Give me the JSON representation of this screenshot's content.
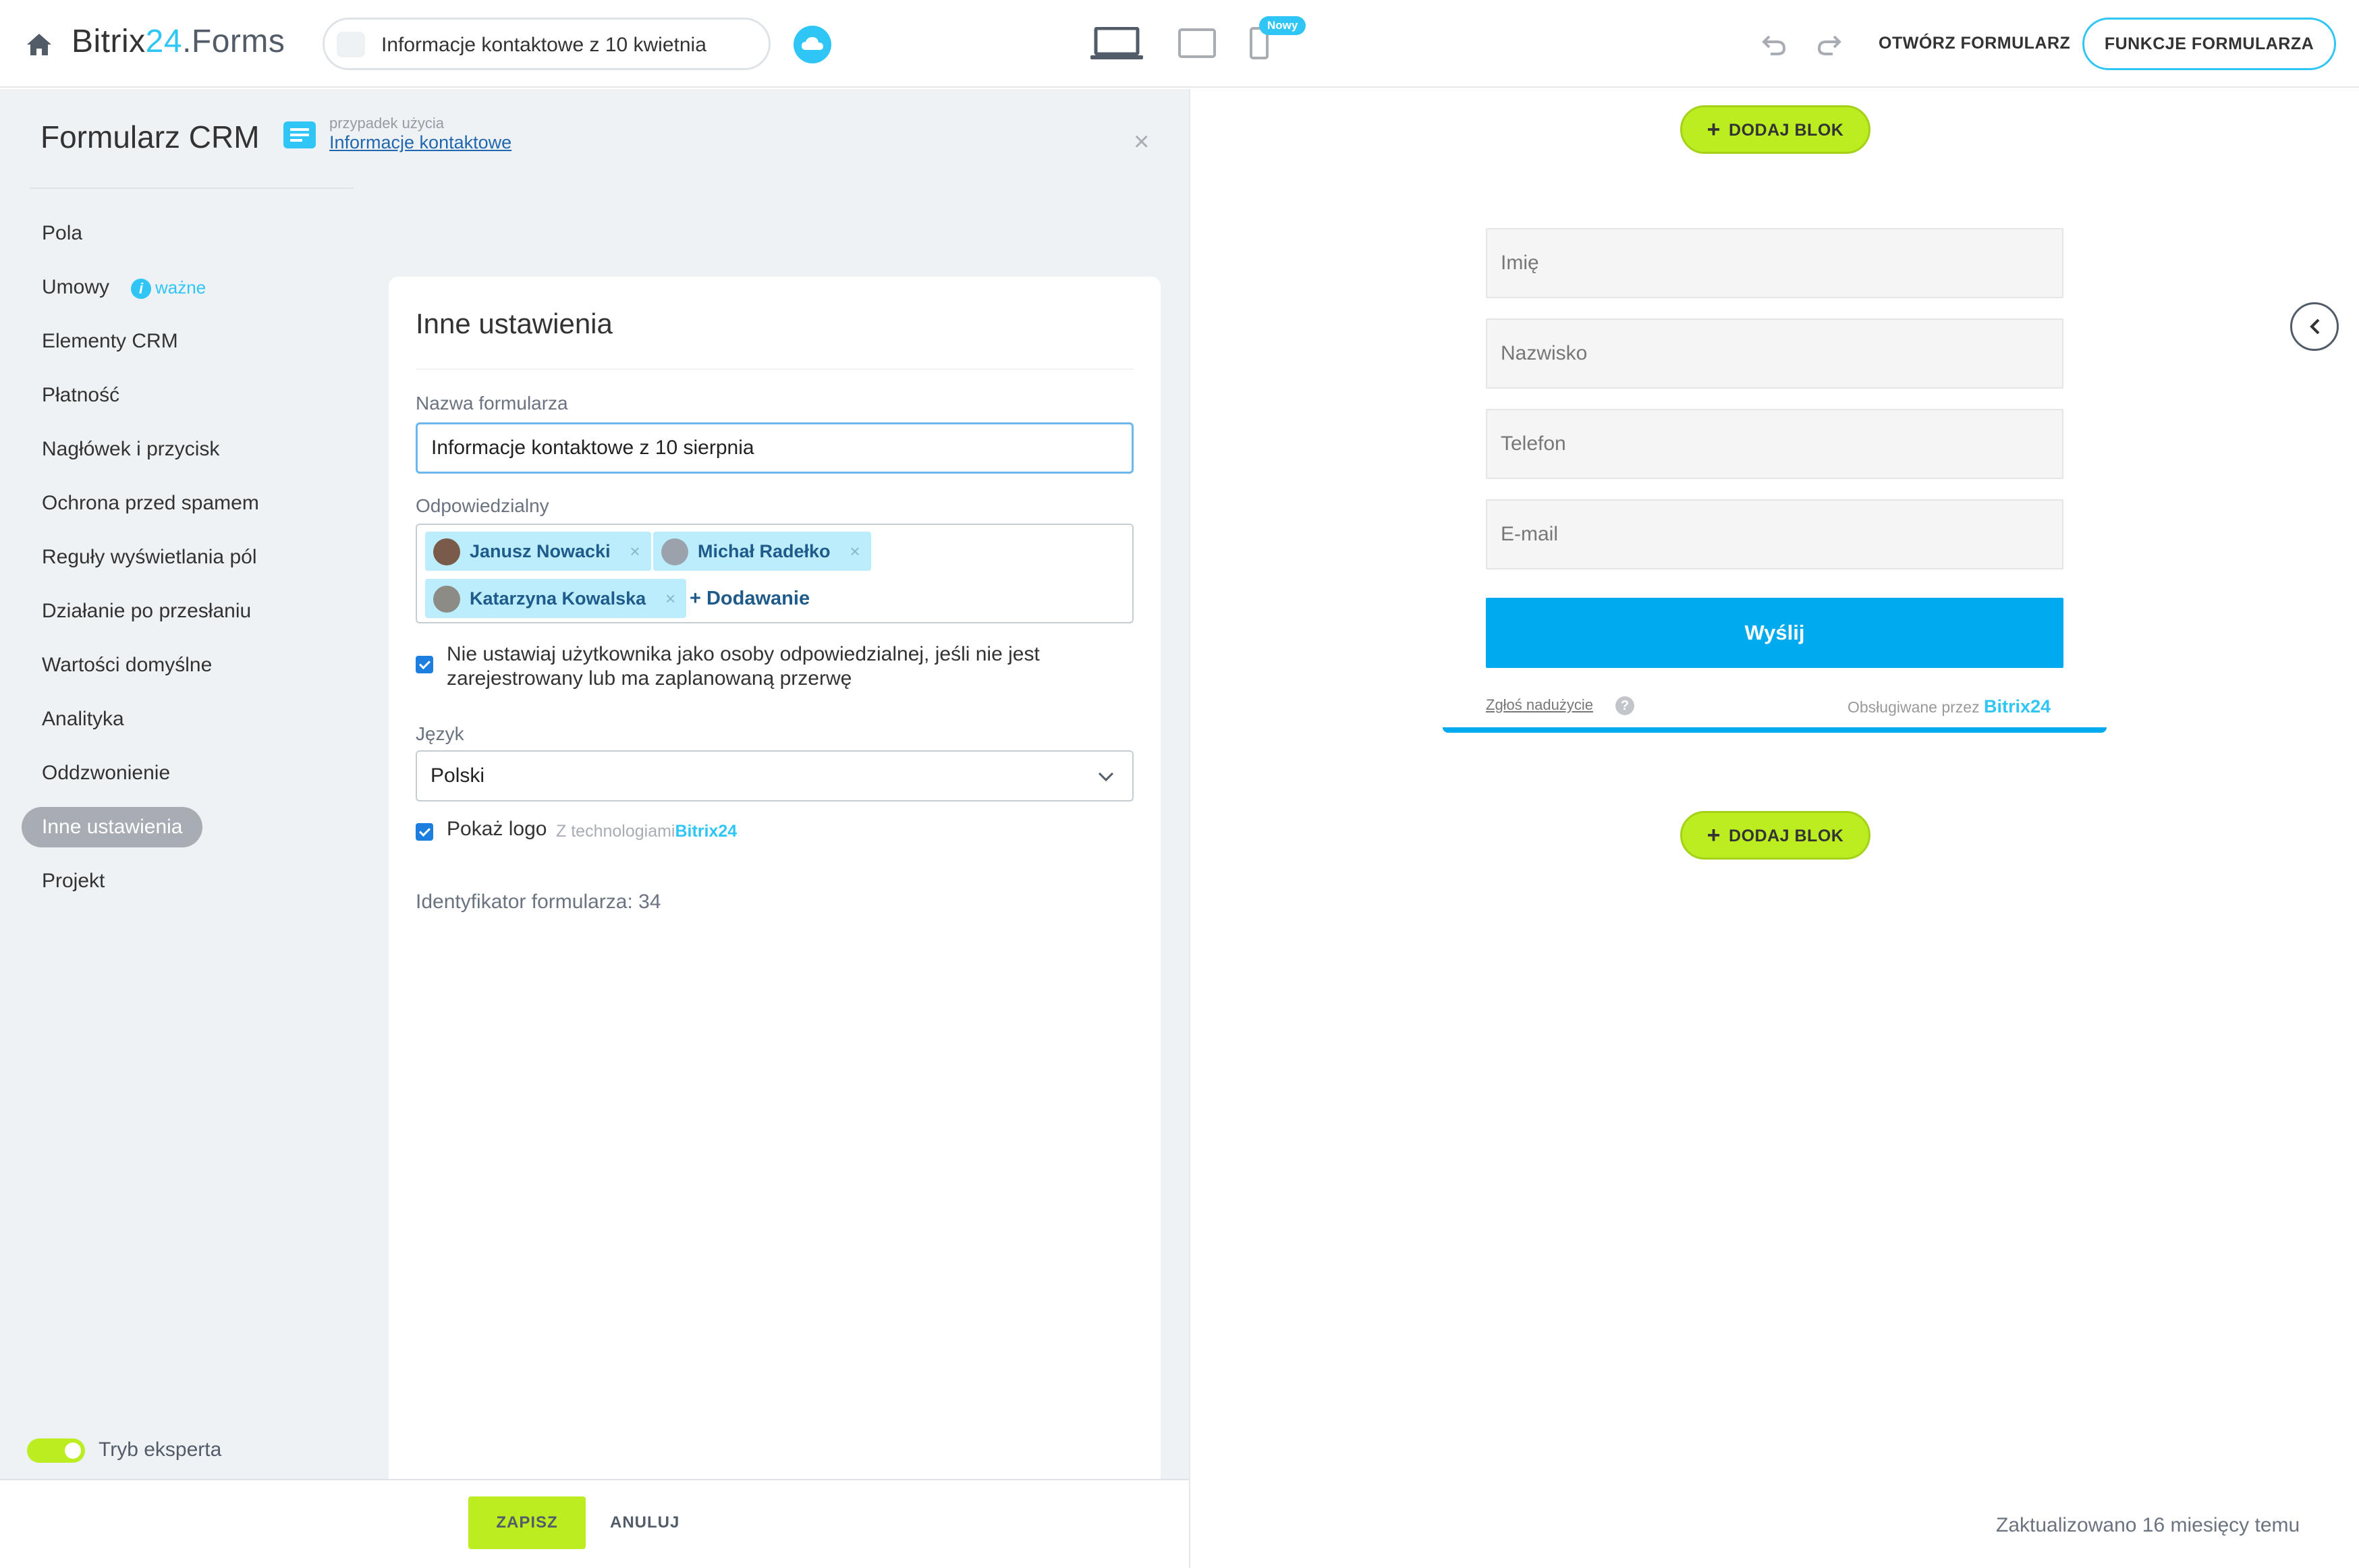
{
  "header": {
    "brand_a": "Bitrix",
    "brand_b": "24",
    "brand_c": ".Forms",
    "form_title": "Informacje kontaktowe z 10 kwietnia",
    "new_badge": "Nowy",
    "open_form": "OTWÓRZ FORMULARZ",
    "form_functions": "FUNKCJE FORMULARZA"
  },
  "panel": {
    "title": "Formularz CRM",
    "usecase_label": "przypadek użycia",
    "usecase_link": "Informacje kontaktowe",
    "close": "×"
  },
  "nav": {
    "items": [
      {
        "label": "Pola"
      },
      {
        "label": "Umowy",
        "badge": "ważne"
      },
      {
        "label": "Elementy CRM"
      },
      {
        "label": "Płatność"
      },
      {
        "label": "Nagłówek i przycisk"
      },
      {
        "label": "Ochrona przed spamem"
      },
      {
        "label": "Reguły wyświetlania pól"
      },
      {
        "label": "Działanie po przesłaniu"
      },
      {
        "label": "Wartości domyślne"
      },
      {
        "label": "Analityka"
      },
      {
        "label": "Oddzwonienie"
      },
      {
        "label": "Inne ustawienia",
        "active": true
      },
      {
        "label": "Projekt"
      }
    ],
    "info_glyph": "i",
    "expert_mode": "Tryb eksperta"
  },
  "settings": {
    "title": "Inne ustawienia",
    "name_label": "Nazwa formularza",
    "name_value": "Informacje kontaktowe z 10 sierpnia",
    "responsible_label": "Odpowiedzialny",
    "responsible": [
      {
        "name": "Janusz Nowacki"
      },
      {
        "name": "Michał Radełko"
      },
      {
        "name": "Katarzyna Kowalska"
      }
    ],
    "remove_glyph": "×",
    "add_user": "+ Dodawanie",
    "no_assign_checkbox": "Nie ustawiaj użytkownika jako osoby odpowiedzialnej, jeśli nie jest zarejestrowany lub ma zaplanowaną przerwę",
    "language_label": "Język",
    "language_value": "Polski",
    "show_logo_label": "Pokaż logo",
    "show_logo_sub": "Z technologiami",
    "show_logo_brand": "Bitrix24",
    "form_id": "Identyfikator formularza: 34"
  },
  "footer": {
    "save": "ZAPISZ",
    "cancel": "ANULUJ",
    "updated": "Zaktualizowano 16 miesięcy temu"
  },
  "preview": {
    "add_block": "DODAJ BLOK",
    "plus_glyph": "+",
    "fields": [
      "Imię",
      "Nazwisko",
      "Telefon",
      "E-mail"
    ],
    "send": "Wyślij",
    "report_abuse": "Zgłoś nadużycie",
    "help_glyph": "?",
    "powered_by": "Obsługiwane przez",
    "powered_brand": "Bitrix24"
  },
  "colors": {
    "accent": "#2fc6f6",
    "green": "#bbed21",
    "submit": "#00aaee"
  }
}
